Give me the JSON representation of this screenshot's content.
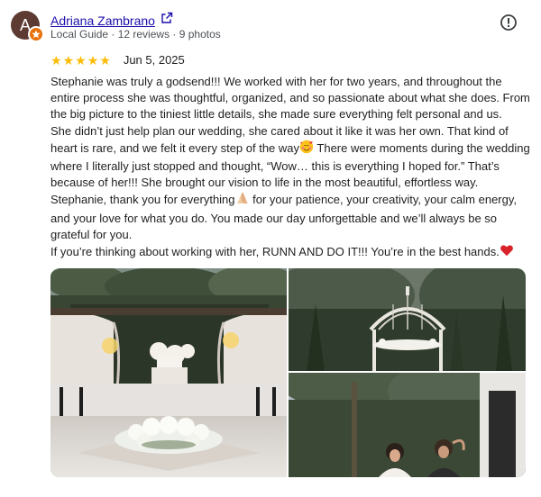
{
  "reviewer": {
    "initial": "A",
    "name": "Adriana Zambrano",
    "meta": "Local Guide · 12 reviews · 9 photos",
    "avatar_color": "#5e3b32",
    "badge_color": "#e8710a",
    "link_color": "#1a0dab"
  },
  "review": {
    "rating": 5,
    "star_color": "#fbbc04",
    "date": "Jun 5, 2025",
    "paragraphs": [
      {
        "text": "Stephanie was truly a godsend!!! We worked with her for two years, and throughout the entire process she was thoughtful, organized, and so passionate about what she does. From the big picture to the tiniest little details, she made sure everything felt personal and us."
      },
      {
        "text_before": "She didn’t just help plan our wedding, she cared about it like it was her own. That kind of heart is rare, and we felt it every step of the way",
        "emoji": "smiling-face-with-hearts-icon",
        "text_after": " There were moments during the wedding where I literally just stopped and thought, “Wow… this is everything I hoped for.” That’s because of her!!! She brought our vision to life in the most beautiful, effortless way."
      },
      {
        "text_before": "Stephanie, thank you for everything",
        "emoji": "folded-hands-icon",
        "text_after": " for your patience, your creativity, your calm energy, and your love for what you do. You made our day unforgettable and we’ll always be so grateful for you."
      },
      {
        "text_before": "If you’re thinking about working with her, RUNN AND DO IT!!! You’re in the best hands.",
        "emoji": "red-heart-icon",
        "text_after": ""
      }
    ]
  },
  "icons": {
    "external_link": "external-link-icon",
    "more_options": "report-icon",
    "badge": "local-guide-star-icon"
  },
  "photos": [
    {
      "name": "photo-ceremony-arch"
    },
    {
      "name": "photo-gazebo"
    },
    {
      "name": "photo-couple"
    }
  ]
}
